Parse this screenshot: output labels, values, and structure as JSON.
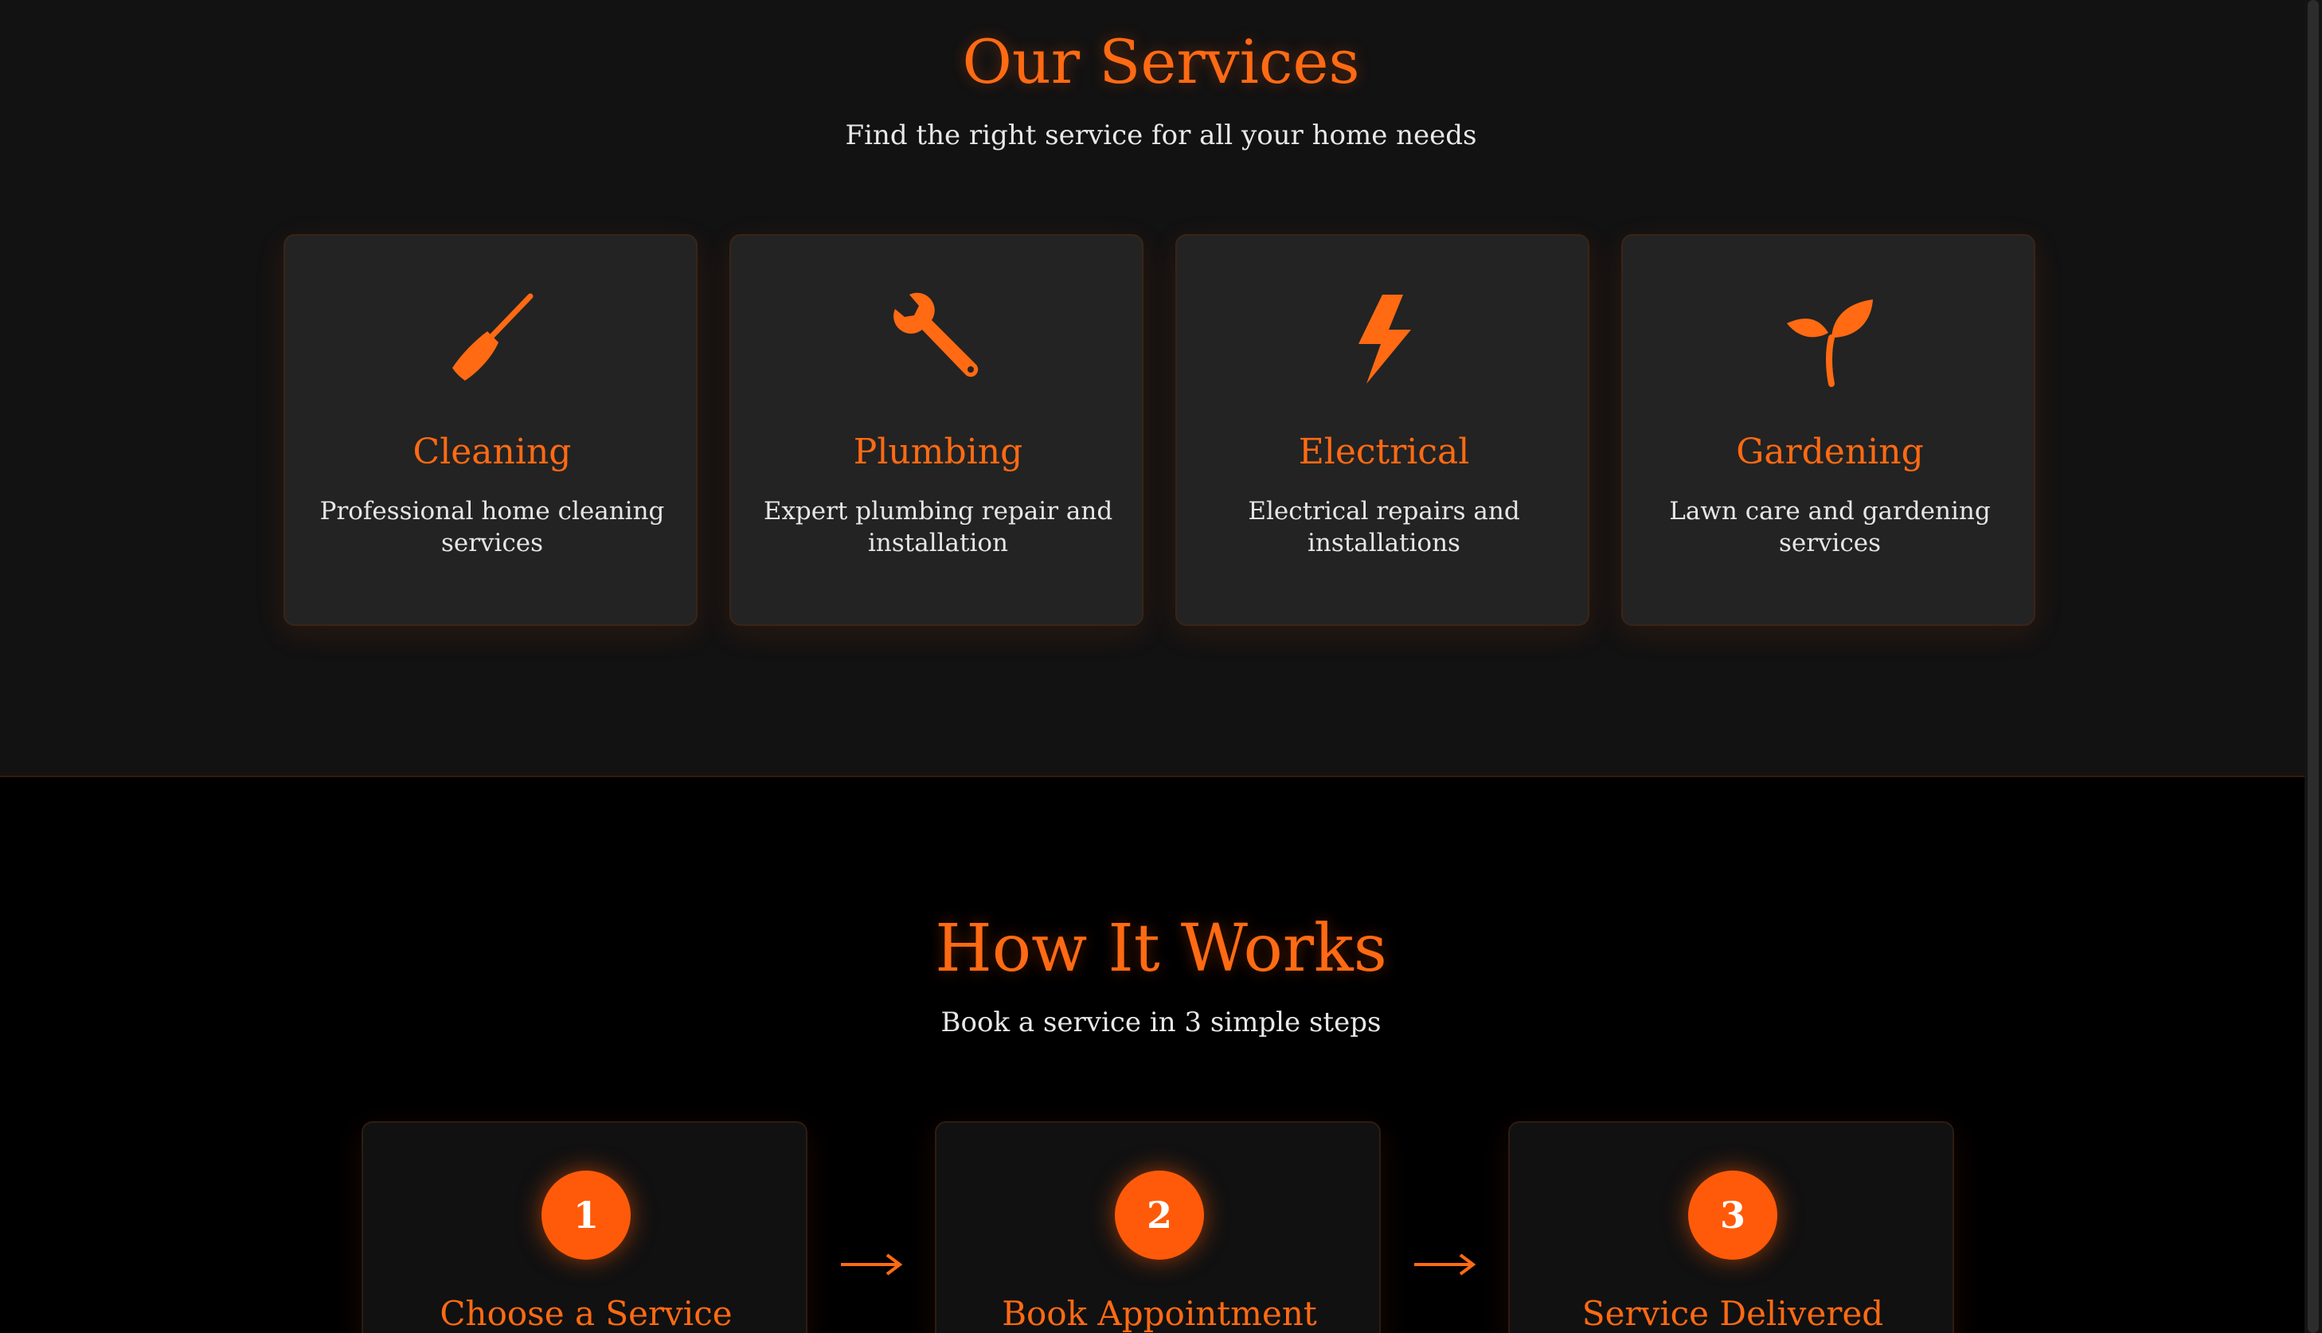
{
  "services": {
    "title": "Our Services",
    "subtitle": "Find the right service for all your home needs",
    "cards": [
      {
        "icon": "broom-icon",
        "title": "Cleaning",
        "description": "Professional home cleaning services"
      },
      {
        "icon": "wrench-icon",
        "title": "Plumbing",
        "description": "Expert plumbing repair and installation"
      },
      {
        "icon": "lightning-icon",
        "title": "Electrical",
        "description": "Electrical repairs and installations"
      },
      {
        "icon": "sprout-icon",
        "title": "Gardening",
        "description": "Lawn care and gardening services"
      }
    ]
  },
  "how_it_works": {
    "title": "How It Works",
    "subtitle": "Book a service in 3 simple steps",
    "steps": [
      {
        "number": "1",
        "title": "Choose a Service"
      },
      {
        "number": "2",
        "title": "Book Appointment"
      },
      {
        "number": "3",
        "title": "Service Delivered"
      }
    ],
    "arrow": "→"
  },
  "colors": {
    "accent": "#ff6a13",
    "step_badge": "#ff5a09",
    "services_bg": "#121212",
    "card_bg": "#232323",
    "how_bg": "#000000"
  }
}
